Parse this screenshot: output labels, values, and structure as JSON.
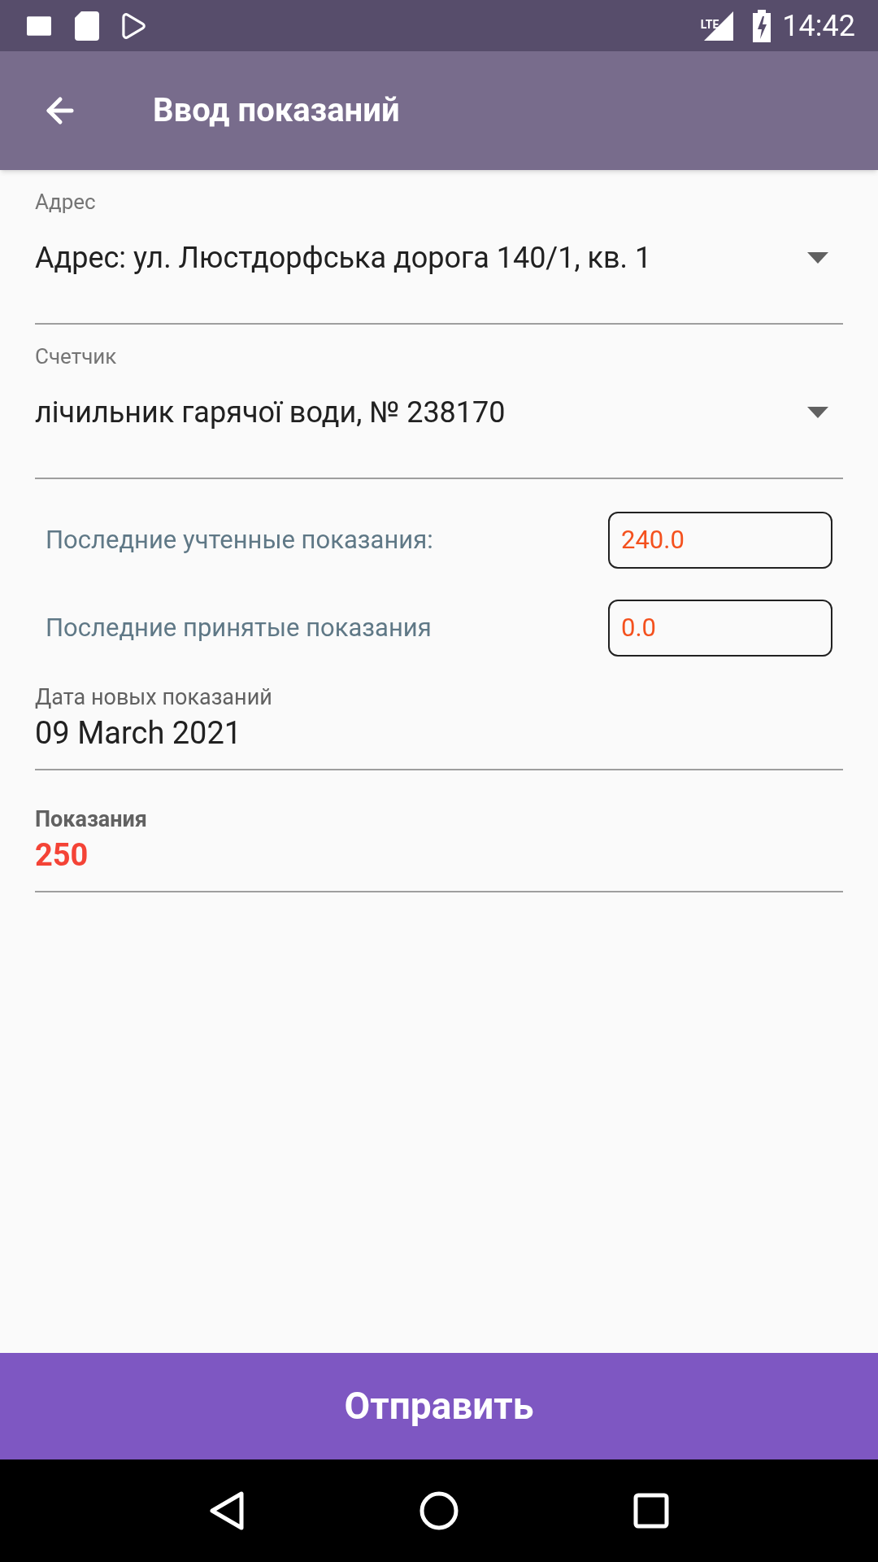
{
  "status_bar": {
    "network": "LTE",
    "time": "14:42"
  },
  "app_bar": {
    "title": "Ввод показаний"
  },
  "fields": [
    {
      "kind": "dropdown",
      "label": "Адрес",
      "value": "Адрес: ул. Люстдорфська дорога 140/1, кв. 1"
    },
    {
      "kind": "dropdown",
      "label": "Счетчик",
      "value": "лічильник гарячої води, № 238170"
    },
    {
      "kind": "readout",
      "label": "Последние учтенные показания:",
      "value": "240.0"
    },
    {
      "kind": "readout",
      "label": "Последние принятые показания",
      "value": "0.0"
    },
    {
      "kind": "text",
      "label": "Дата новых показаний",
      "value": "09 March 2021"
    },
    {
      "kind": "entry",
      "label": "Показания",
      "value": "250"
    }
  ],
  "submit_button": "Отправить"
}
